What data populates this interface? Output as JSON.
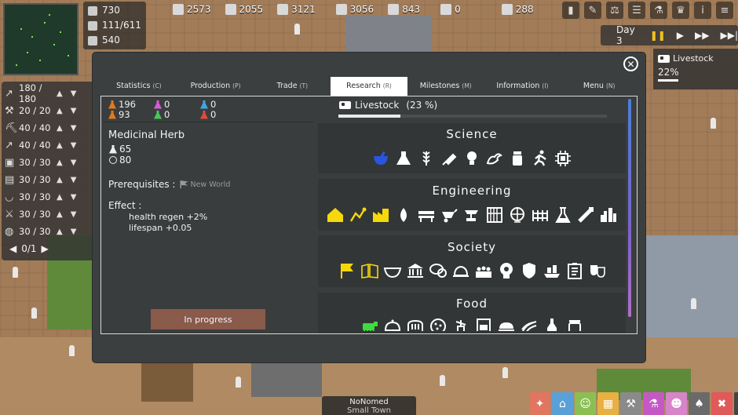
{
  "hud": {
    "resources": [
      {
        "icon": "wood-icon",
        "value": "2573"
      },
      {
        "icon": "stone-icon",
        "value": "2055"
      },
      {
        "icon": "iron-icon",
        "value": "3121"
      },
      {
        "icon": "tools-icon",
        "value": "3056"
      },
      {
        "icon": "building-icon",
        "value": "843"
      },
      {
        "icon": "grain-icon",
        "value": "0"
      },
      {
        "icon": "flask-icon",
        "value": "288"
      }
    ],
    "population": [
      "730",
      "111/611",
      "540"
    ],
    "day": "Day 3",
    "tools": [
      {
        "icon": "hoe-icon",
        "value": "180 / 180"
      },
      {
        "icon": "hammer-icon",
        "value": "20 / 20"
      },
      {
        "icon": "pickaxe-icon",
        "value": "40 / 40"
      },
      {
        "icon": "spear-icon",
        "value": "40 / 40"
      },
      {
        "icon": "shield-icon",
        "value": "30 / 30"
      },
      {
        "icon": "cart-icon",
        "value": "30 / 30"
      },
      {
        "icon": "bowl-icon",
        "value": "30 / 30"
      },
      {
        "icon": "axe-icon",
        "value": "30 / 30"
      },
      {
        "icon": "bag-icon",
        "value": "30 / 30"
      }
    ],
    "tools_pager": "0/1",
    "side_research": {
      "name": "Livestock",
      "percent": "22%",
      "progress": 0.22
    },
    "town": {
      "name": "NoNomed",
      "type": "Small Town"
    }
  },
  "modal": {
    "tabs": [
      {
        "label": "Statistics",
        "key": "(C)"
      },
      {
        "label": "Production",
        "key": "(P)"
      },
      {
        "label": "Trade",
        "key": "(T)"
      },
      {
        "label": "Research",
        "key": "(R)"
      },
      {
        "label": "Milestones",
        "key": "(M)"
      },
      {
        "label": "Information",
        "key": "(I)"
      },
      {
        "label": "Menu",
        "key": "(N)"
      }
    ],
    "active_tab": "Research",
    "research_points": [
      {
        "color": "#e07a20",
        "value": "196"
      },
      {
        "color": "#e07a20",
        "value": "93"
      },
      {
        "color": "#d65bd6",
        "value": "0"
      },
      {
        "color": "#47c85a",
        "value": "0"
      },
      {
        "color": "#3ea6e8",
        "value": "0"
      },
      {
        "color": "#e04a3a",
        "value": "0"
      }
    ],
    "current_research": {
      "name": "Livestock",
      "percent": "(23 %)",
      "progress": 0.23
    },
    "selected_tech": {
      "name": "Medicinal Herb",
      "cost_points": "65",
      "cost_time": "80",
      "prerequisites_label": "Prerequisites :",
      "prerequisite": "New World",
      "effect_label": "Effect :",
      "effects": [
        "health regen +2%",
        "lifespan +0.05"
      ],
      "status": "In progress"
    },
    "categories": [
      {
        "title": "Science",
        "techs": [
          "mortar-icon",
          "flask-icon",
          "wheat-icon",
          "syringe-icon",
          "lightbulb-icon",
          "muscle-icon",
          "pill-bottle-icon",
          "runner-icon",
          "chip-icon"
        ]
      },
      {
        "title": "Engineering",
        "techs": [
          "house-icon",
          "survey-icon",
          "factory-icon",
          "water-drop-icon",
          "bench-icon",
          "wheelbarrow-icon",
          "anvil-icon",
          "loom-icon",
          "globe-icon",
          "fence-icon",
          "beaker-icon",
          "pipe-icon",
          "city-icon"
        ]
      },
      {
        "title": "Society",
        "techs": [
          "flag-icon",
          "book-icon",
          "bowl-icon",
          "temple-icon",
          "speech-icon",
          "bell-icon",
          "crowd-icon",
          "head-idea-icon",
          "badge-icon",
          "ship-icon",
          "clipboard-icon",
          "masks-icon"
        ]
      },
      {
        "title": "Food",
        "techs": [
          "cow-icon",
          "cloche-icon",
          "bread-icon",
          "cookie-icon",
          "mill-icon",
          "oven-icon",
          "dish-icon",
          "field-icon",
          "bottle-icon",
          "jar-icon"
        ]
      }
    ],
    "colors": {
      "researched": "#f5d90a",
      "in_progress": "#2a55e0",
      "food_active": "#3fdc3f",
      "available": "#ffffff"
    }
  }
}
